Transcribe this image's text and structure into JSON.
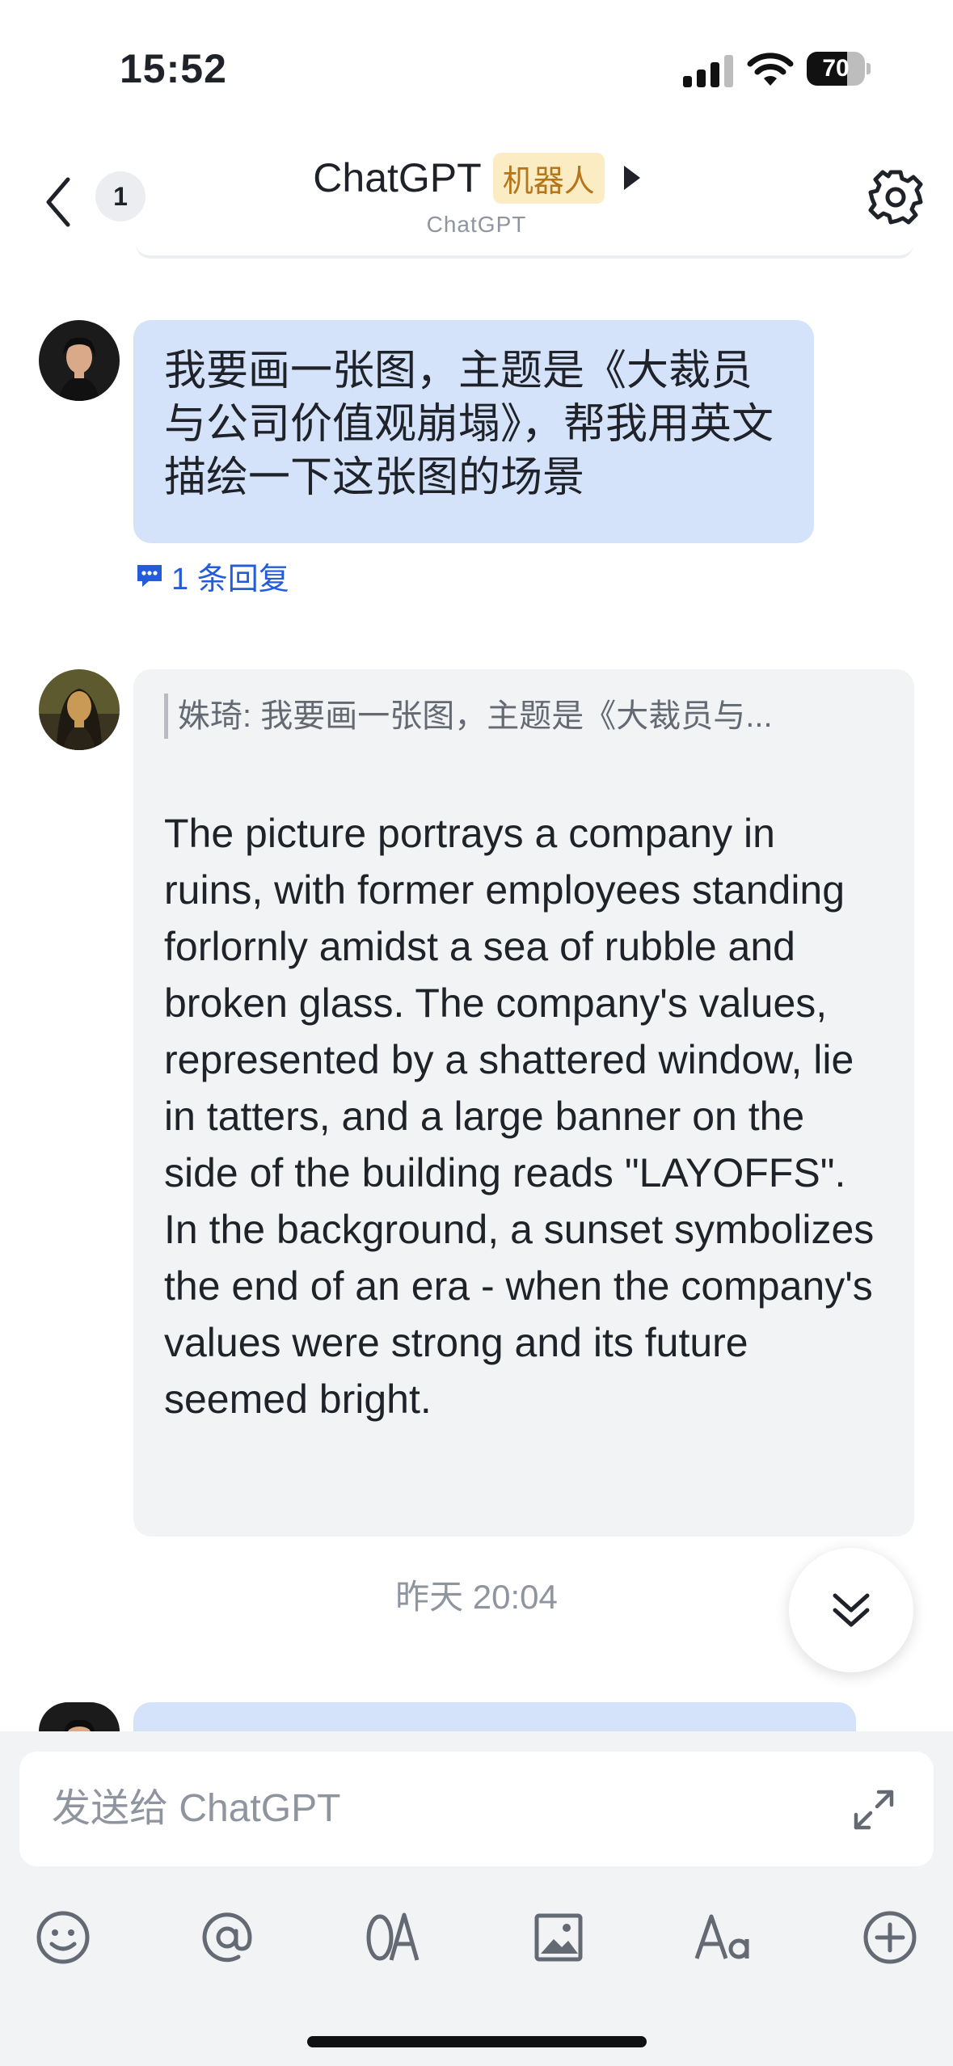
{
  "status_bar": {
    "time": "15:52",
    "battery": "70",
    "battery_level": 0.7
  },
  "nav": {
    "unread_count": "1",
    "title": "ChatGPT",
    "bot_tag": "机器人",
    "subtitle": "ChatGPT",
    "icons": {
      "back": "chevron-left-icon",
      "settings": "gear-icon",
      "expand": "play-arrow-icon"
    }
  },
  "messages": [
    {
      "sender": "user",
      "text": "我要画一张图，主题是《大裁员与公司价值观崩塌》，帮我用英文描绘一下这张图的场景",
      "reply_link": "1 条回复"
    },
    {
      "sender": "bot",
      "quote": "姝琦: 我要画一张图，主题是《大裁员与...",
      "text": "The picture portrays a company in ruins, with former employees standing forlornly amidst a sea of rubble and broken glass. The company's values, represented by a shattered window, lie in tatters, and a large banner on the side of the building reads \"LAYOFFS\". In the background, a sunset symbolizes the end of an era - when the company's values were strong and its future seemed bright."
    }
  ],
  "timestamp": "昨天 20:04",
  "composer": {
    "placeholder": "发送给 ChatGPT",
    "tools": [
      "emoji-icon",
      "mention-icon",
      "translate-icon",
      "image-icon",
      "font-format-icon",
      "plus-icon"
    ]
  },
  "colors": {
    "user_bubble": "#d4e2fa",
    "bot_bubble": "#f2f3f5",
    "bot_tag_bg": "#fbecc4",
    "bot_tag_text": "#b3761a",
    "link": "#245bdb"
  }
}
